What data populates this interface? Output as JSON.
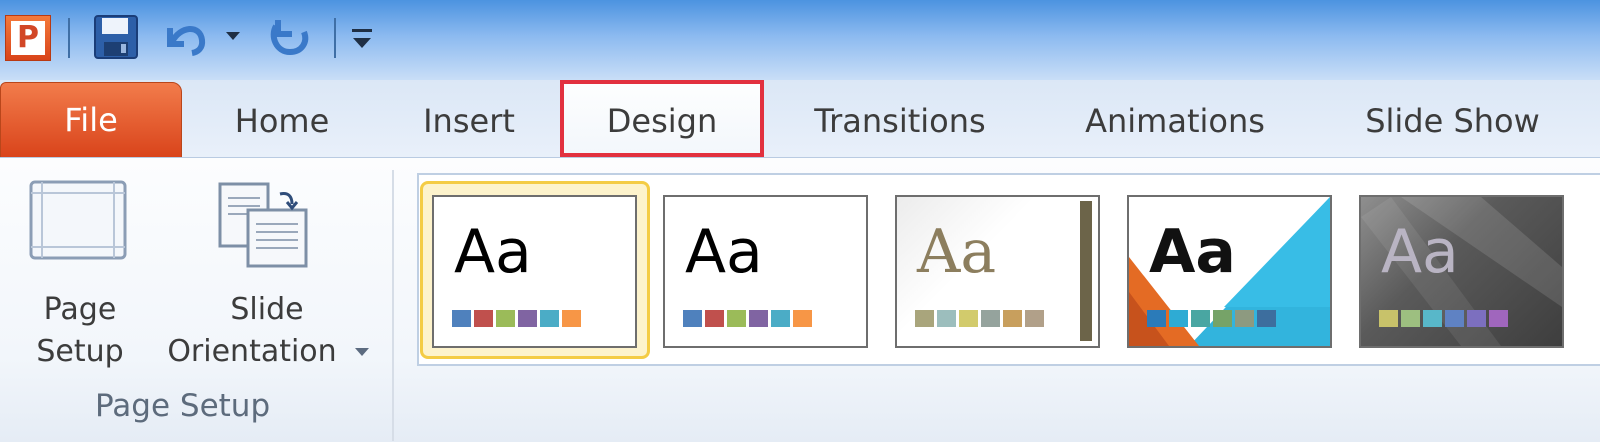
{
  "qat": {
    "app_letter": "P",
    "icons": [
      "powerpoint-app-icon",
      "save-icon",
      "undo-icon",
      "undo-dropdown-icon",
      "redo-icon",
      "customize-qat-icon"
    ]
  },
  "tabs": {
    "file": "File",
    "home": "Home",
    "insert": "Insert",
    "design": "Design",
    "transitions": "Transitions",
    "animations": "Animations",
    "slideshow": "Slide Show"
  },
  "page_setup_group": {
    "page_setup_line1": "Page",
    "page_setup_line2": "Setup",
    "orientation_line1": "Slide",
    "orientation_line2": "Orientation",
    "group_label": "Page Setup"
  },
  "themes": [
    {
      "aa": "Aa",
      "aa_color": "#000000",
      "swatches": [
        "#4f81bd",
        "#c0504d",
        "#9bbb59",
        "#8064a2",
        "#4bacc6",
        "#f79646"
      ]
    },
    {
      "aa": "Aa",
      "aa_color": "#000000",
      "swatches": [
        "#4f81bd",
        "#c0504d",
        "#9bbb59",
        "#8064a2",
        "#4bacc6",
        "#f79646"
      ]
    },
    {
      "aa": "Aa",
      "aa_color": "#8c7e5e",
      "swatches": [
        "#a9a57c",
        "#9cbebd",
        "#d2cb6c",
        "#95a39d",
        "#c89f5d",
        "#b1a089"
      ]
    },
    {
      "aa": "Aa",
      "aa_color": "#111111",
      "swatches": [
        "#2b7bb9",
        "#2eabd4",
        "#49a6a2",
        "#76a368",
        "#8d9a80",
        "#3d6e9e"
      ]
    },
    {
      "aa": "Aa",
      "aa_color": "#b9b4c3",
      "swatches": [
        "#c8c26a",
        "#9dbf80",
        "#58b7c9",
        "#5f82c3",
        "#7c6fbf",
        "#a066bd"
      ]
    }
  ],
  "accent": {
    "file_tab": "#d9441b",
    "highlight_box": "#e2313f",
    "selected_theme": "#f4cc45"
  }
}
